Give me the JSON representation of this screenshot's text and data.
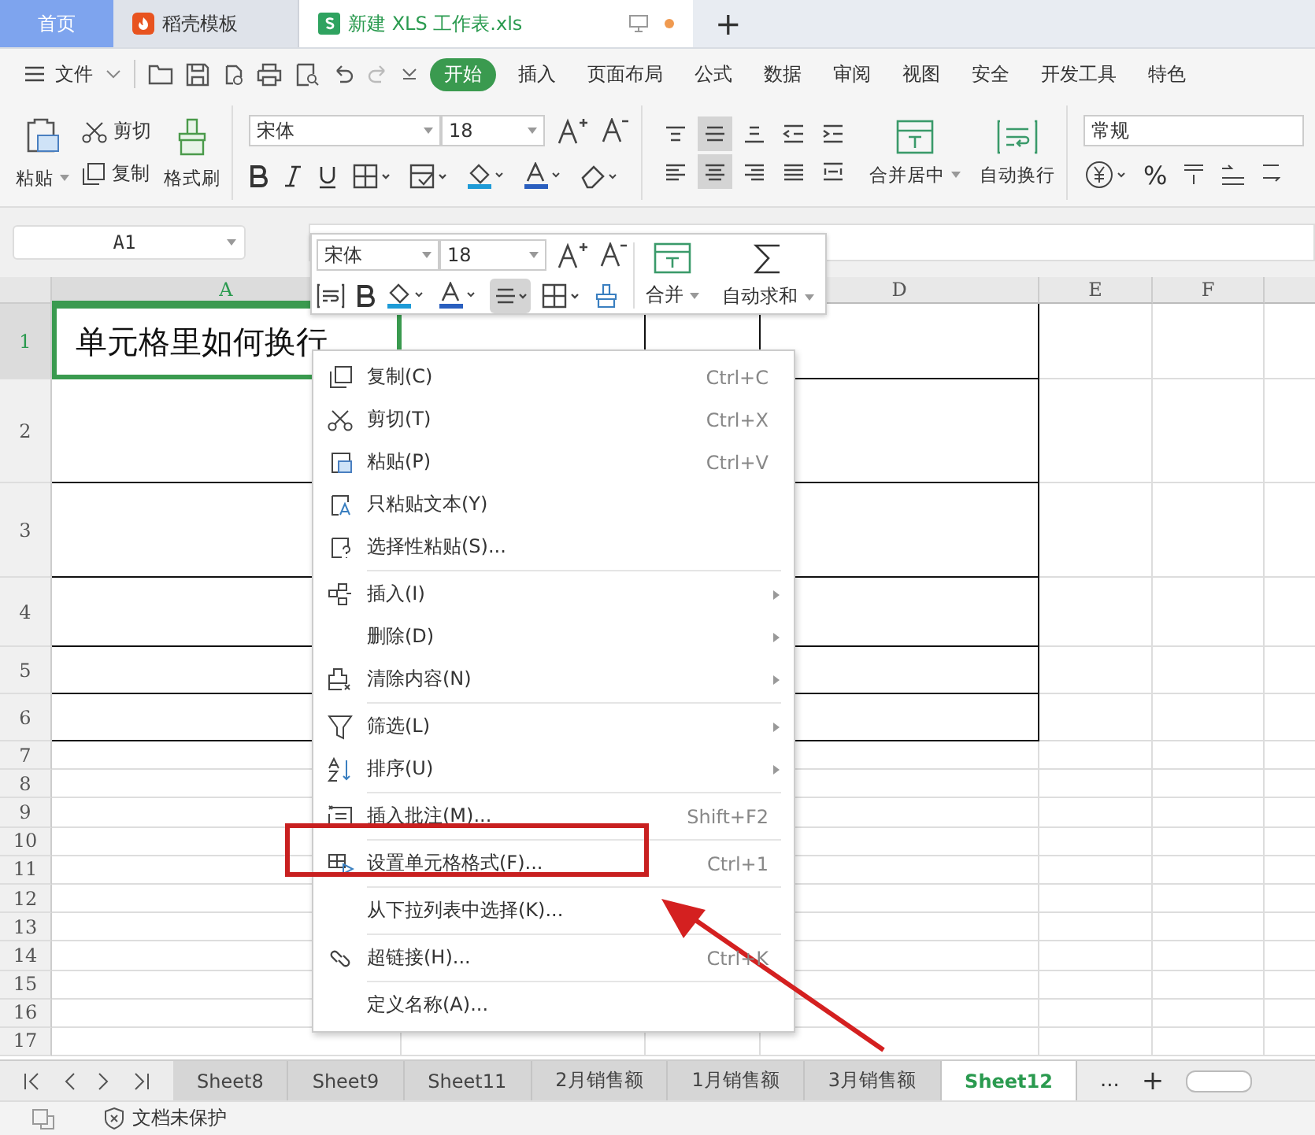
{
  "tabs": [
    {
      "label": "首页",
      "kind": "home",
      "selected": false
    },
    {
      "label": "稻壳模板",
      "kind": "docer",
      "selected": false
    },
    {
      "label": "新建 XLS 工作表.xls",
      "kind": "sheet",
      "selected": true,
      "unsaved": true
    }
  ],
  "new_tab": "+",
  "menu": {
    "file": "文件",
    "tabs": [
      {
        "label": "开始",
        "selected": true
      },
      {
        "label": "插入",
        "selected": false
      },
      {
        "label": "页面布局",
        "selected": false
      },
      {
        "label": "公式",
        "selected": false
      },
      {
        "label": "数据",
        "selected": false
      },
      {
        "label": "审阅",
        "selected": false
      },
      {
        "label": "视图",
        "selected": false
      },
      {
        "label": "安全",
        "selected": false
      },
      {
        "label": "开发工具",
        "selected": false
      },
      {
        "label": "特色",
        "selected": false
      }
    ]
  },
  "ribbon": {
    "paste": "粘贴",
    "cut": "剪切",
    "copy": "复制",
    "format_painter": "格式刷",
    "font": "宋体",
    "size": "18",
    "align_top": [
      {
        "selected": false
      },
      {
        "selected": true
      },
      {
        "selected": false
      }
    ],
    "align_bottom": [
      {
        "selected": false
      },
      {
        "selected": true
      },
      {
        "selected": false
      }
    ],
    "merge": "合并居中",
    "wrap": "自动换行",
    "number_format": "常规",
    "percent": "%"
  },
  "name_box": "A1",
  "mini_toolbar": {
    "font": "宋体",
    "size": "18",
    "align_selected": true,
    "merge": "合并",
    "autosum": "自动求和"
  },
  "grid": {
    "column_headers": [
      "A",
      "D",
      "E",
      "F"
    ],
    "row_headers": [
      "1",
      "2",
      "3",
      "4",
      "5",
      "6",
      "7",
      "8",
      "9",
      "10",
      "11",
      "12",
      "13",
      "14",
      "15",
      "16",
      "17"
    ],
    "cell_a1": {
      "text": "单元格里如何换行",
      "selected": true
    }
  },
  "context_menu": {
    "sections": [
      [
        {
          "label": "复制(C)",
          "shortcut": "Ctrl+C",
          "submenu": false
        },
        {
          "label": "剪切(T)",
          "shortcut": "Ctrl+X",
          "submenu": false
        },
        {
          "label": "粘贴(P)",
          "shortcut": "Ctrl+V",
          "submenu": false
        },
        {
          "label": "只粘贴文本(Y)",
          "submenu": false
        },
        {
          "label": "选择性粘贴(S)...",
          "submenu": false
        }
      ],
      [
        {
          "label": "插入(I)",
          "submenu": true
        },
        {
          "label": "删除(D)",
          "submenu": true
        },
        {
          "label": "清除内容(N)",
          "submenu": true
        }
      ],
      [
        {
          "label": "筛选(L)",
          "submenu": true
        },
        {
          "label": "排序(U)",
          "submenu": true
        }
      ],
      [
        {
          "label": "插入批注(M)...",
          "shortcut": "Shift+F2",
          "submenu": false
        }
      ],
      [
        {
          "label": "设置单元格格式(F)...",
          "shortcut": "Ctrl+1",
          "submenu": false,
          "annotated": true
        }
      ],
      [
        {
          "label": "从下拉列表中选择(K)...",
          "submenu": false
        }
      ],
      [
        {
          "label": "超链接(H)...",
          "shortcut": "Ctrl+K",
          "submenu": false
        }
      ],
      [
        {
          "label": "定义名称(A)...",
          "submenu": false
        }
      ]
    ]
  },
  "sheet_tabs": [
    {
      "label": "Sheet8",
      "selected": false
    },
    {
      "label": "Sheet9",
      "selected": false
    },
    {
      "label": "Sheet11",
      "selected": false
    },
    {
      "label": "2月销售额",
      "selected": false
    },
    {
      "label": "1月销售额",
      "selected": false
    },
    {
      "label": "3月销售额",
      "selected": false
    },
    {
      "label": "Sheet12",
      "selected": true
    }
  ],
  "sheet_more": "...",
  "sheet_add": "+",
  "status": {
    "protection": "文档未保护"
  }
}
